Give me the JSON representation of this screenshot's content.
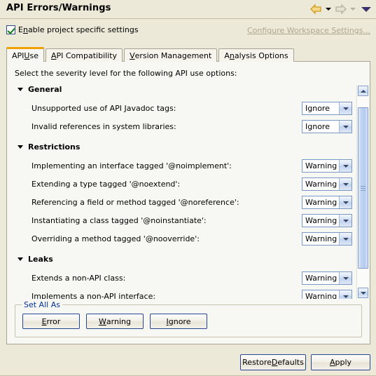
{
  "header": {
    "title": "API Errors/Warnings",
    "nav": {
      "back_icon": "back-arrow-icon",
      "back_caret_icon": "chevron-down-icon",
      "forward_icon": "forward-arrow-icon",
      "forward_caret_icon": "chevron-down-icon",
      "menu_icon": "view-menu-icon"
    }
  },
  "enable_checkbox": {
    "checked": true,
    "label_pre": "E",
    "label_accel": "n",
    "label_post": "able project specific settings"
  },
  "workspace_link": {
    "label": "Configure Workspace Settings...",
    "enabled": false
  },
  "tabs": [
    {
      "pre": "API ",
      "accel": "U",
      "post": "se",
      "active": true
    },
    {
      "pre": "",
      "accel": "A",
      "post": "PI Compatibility",
      "active": false
    },
    {
      "pre": "",
      "accel": "V",
      "post": "ersion Management",
      "active": false
    },
    {
      "pre": "A",
      "accel": "n",
      "post": "alysis Options",
      "active": false
    }
  ],
  "panel": {
    "intro": "Select the severity level for the following API use options:"
  },
  "groups": [
    {
      "name": "General",
      "options": [
        {
          "label": "Unsupported use of API Javadoc tags:",
          "value": "Ignore"
        },
        {
          "label": "Invalid references in system libraries:",
          "value": "Ignore"
        }
      ]
    },
    {
      "name": "Restrictions",
      "options": [
        {
          "label": "Implementing an interface tagged '@noimplement':",
          "value": "Warning"
        },
        {
          "label": "Extending a type tagged '@noextend':",
          "value": "Warning"
        },
        {
          "label": "Referencing a field or method tagged '@noreference':",
          "value": "Warning"
        },
        {
          "label": "Instantiating a class tagged '@noinstantiate':",
          "value": "Warning"
        },
        {
          "label": "Overriding a method tagged '@nooverride':",
          "value": "Warning"
        }
      ]
    },
    {
      "name": "Leaks",
      "options": [
        {
          "label": "Extends a non-API class:",
          "value": "Warning"
        },
        {
          "label": "Implements a non-API interface:",
          "value": "Warning"
        }
      ]
    }
  ],
  "scrollbar": {
    "up_icon": "chevron-up-icon",
    "down_icon": "chevron-down-icon",
    "thumb_top_pct": 6,
    "thumb_height_pct": 84
  },
  "set_all_as": {
    "legend": "Set All As",
    "buttons": [
      {
        "pre": "",
        "accel": "E",
        "post": "rror"
      },
      {
        "pre": "",
        "accel": "W",
        "post": "arning"
      },
      {
        "pre": "",
        "accel": "I",
        "post": "gnore"
      }
    ]
  },
  "footer": {
    "restore": {
      "pre": "Restore ",
      "accel": "D",
      "post": "efaults"
    },
    "apply": {
      "pre": "",
      "accel": "A",
      "post": "pply"
    }
  },
  "colors": {
    "window_bg": "#ece9d8",
    "panel_bg": "#f7f7f4",
    "tab_accent": "#f0a000",
    "link_disabled": "#aba78f",
    "legend_blue": "#00339a",
    "check_green": "#107c10",
    "back_arrow": "#e0a72a",
    "forward_arrow": "#d8d5c4",
    "menu_arrow": "#3b326b"
  }
}
